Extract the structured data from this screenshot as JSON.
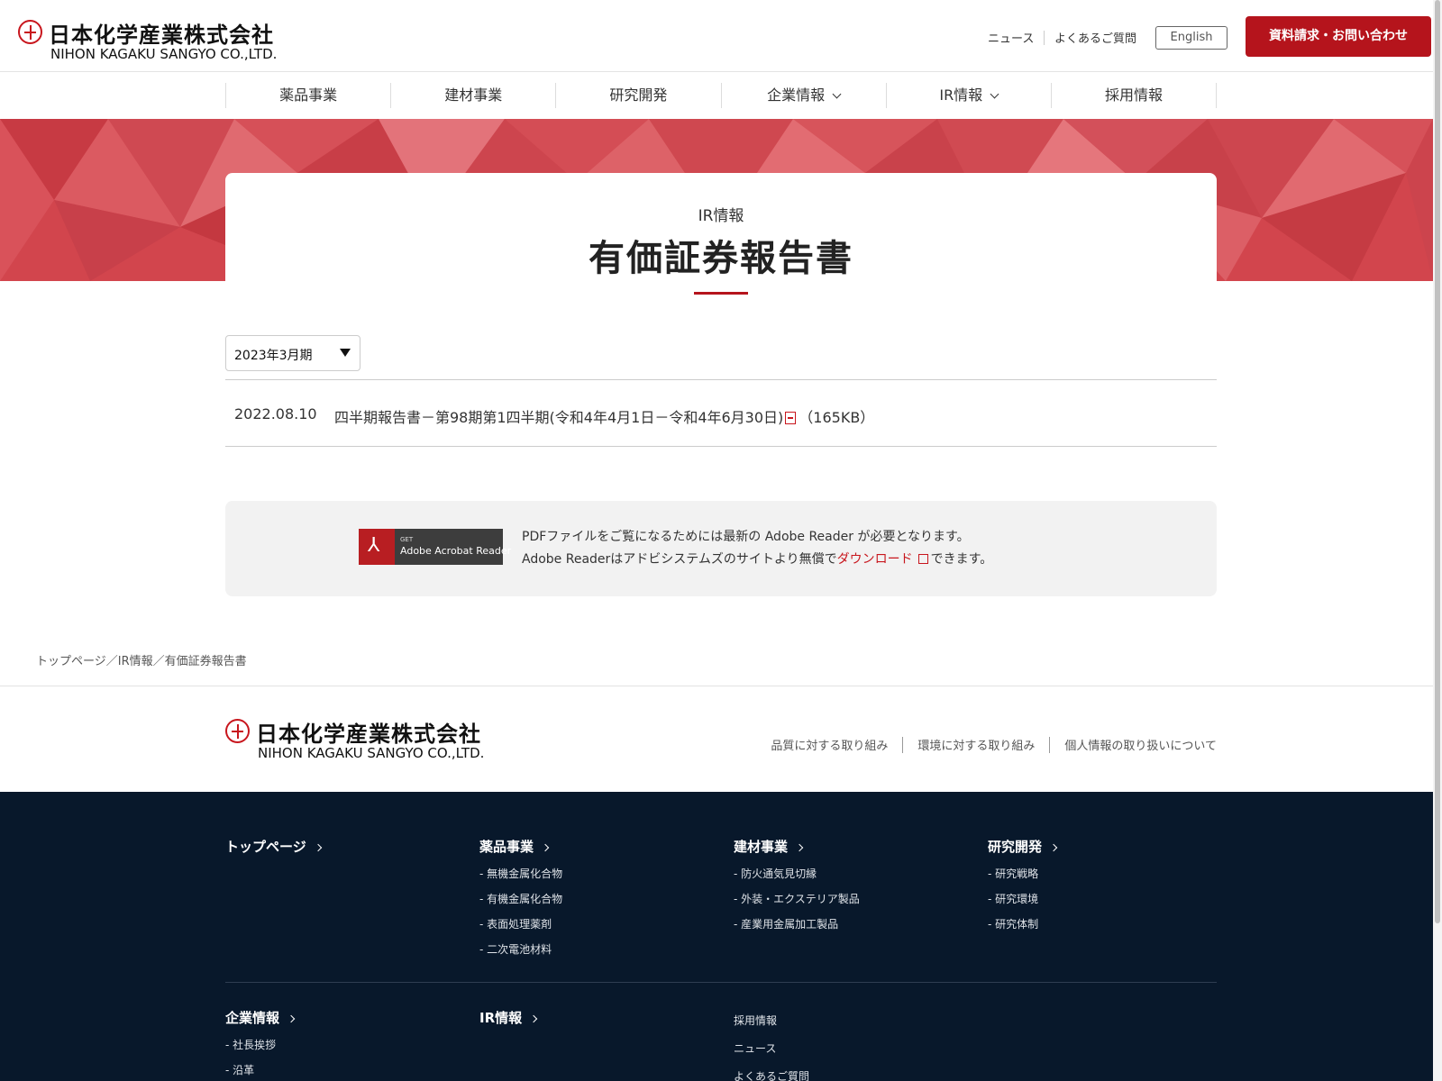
{
  "header": {
    "logo_ja": "日本化学産業株式会社",
    "logo_en": "NIHON KAGAKU SANGYO CO.,LTD.",
    "util_news": "ニュース",
    "util_faq": "よくあるご質問",
    "lang": "English",
    "contact": "資料請求・お問い合わせ"
  },
  "nav": {
    "items": [
      "薬品事業",
      "建材事業",
      "研究開発",
      "企業情報",
      "IR情報",
      "採用情報"
    ]
  },
  "hero": {
    "category": "IR情報",
    "title": "有価証券報告書"
  },
  "period_select": {
    "value": "2023年3月期"
  },
  "reports": [
    {
      "date": "2022.08.10",
      "title": "四半期報告書－第98期第1四半期(令和4年4月1日－令和4年6月30日)",
      "size": "（165KB）"
    }
  ],
  "adobe": {
    "badge_get": "GET",
    "badge_name": "Adobe Acrobat Reader",
    "line1": "PDFファイルをご覧になるためには最新の Adobe Reader が必要となります。",
    "line2_pre": "Adobe Readerはアドビシステムズのサイトより無償で",
    "line2_link": "ダウンロード",
    "line2_post": "できます。"
  },
  "breadcrumb": "トップページ／IR情報／有価証券報告書",
  "footer": {
    "links": [
      "品質に対する取り組み",
      "環境に対する取り組み",
      "個人情報の取り扱いについて"
    ],
    "col_top": "トップページ",
    "col_chem": {
      "head": "薬品事業",
      "items": [
        "無機金属化合物",
        "有機金属化合物",
        "表面処理薬剤",
        "二次電池材料"
      ]
    },
    "col_build": {
      "head": "建材事業",
      "items": [
        "防火通気見切縁",
        "外装・エクステリア製品",
        "産業用金属加工製品"
      ]
    },
    "col_rd": {
      "head": "研究開発",
      "items": [
        "研究戦略",
        "研究環境",
        "研究体制"
      ]
    },
    "col_corp": {
      "head": "企業情報",
      "items": [
        "社長挨拶",
        "沿革"
      ]
    },
    "col_ir": "IR情報",
    "col_misc": [
      "採用情報",
      "ニュース",
      "よくあるご質問"
    ]
  },
  "colors": {
    "brand_red": "#b5141c",
    "hero_red": "#d2454d",
    "footer_navy": "#08182b"
  }
}
